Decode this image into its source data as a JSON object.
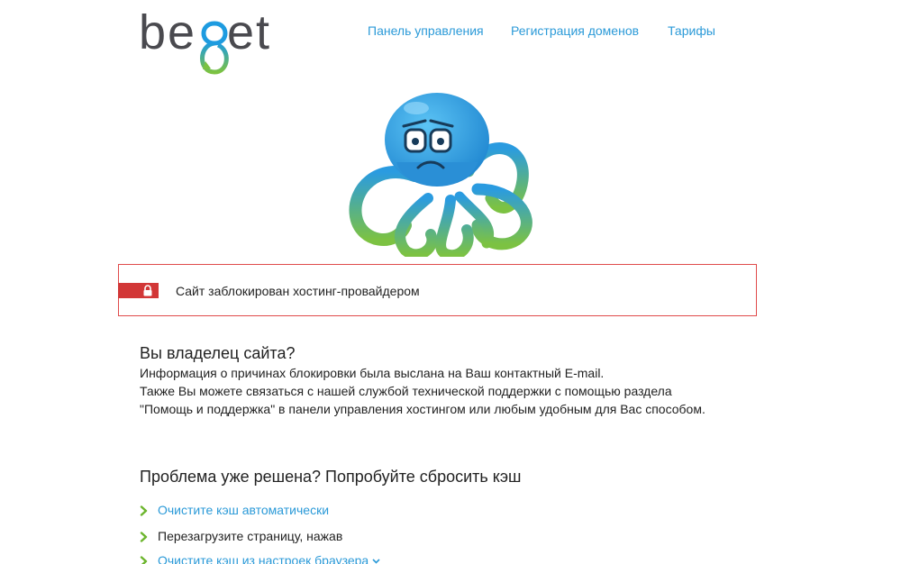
{
  "header": {
    "logo_text": "beget",
    "nav": [
      {
        "label": "Панель управления"
      },
      {
        "label": "Регистрация доменов"
      },
      {
        "label": "Тарифы"
      }
    ]
  },
  "alert": {
    "message": "Сайт заблокирован хостинг-провайдером",
    "icon": "lock-icon"
  },
  "owner": {
    "title": "Вы владелец сайта?",
    "lines": [
      "Информация о причинах блокировки была выслана на Ваш контактный E-mail.",
      "Также Вы можете связаться с нашей службой технической поддержки с помощью раздела",
      "\"Помощь и поддержка\" в панели управления хостингом или любым удобным для Вас способом."
    ]
  },
  "cache": {
    "title": "Проблема уже решена? Попробуйте сбросить кэш",
    "items": [
      {
        "label": "Очистите кэш автоматически",
        "link": true
      },
      {
        "label": "Перезагрузите страницу, нажав",
        "link": false
      },
      {
        "label": "Очистите кэш из настроек браузера",
        "link": true
      }
    ]
  },
  "colors": {
    "accent_blue": "#2b9ad8",
    "alert_red": "#d23737",
    "chevron_green": "#6cb52d",
    "logo_gray": "#4a4a4f"
  }
}
